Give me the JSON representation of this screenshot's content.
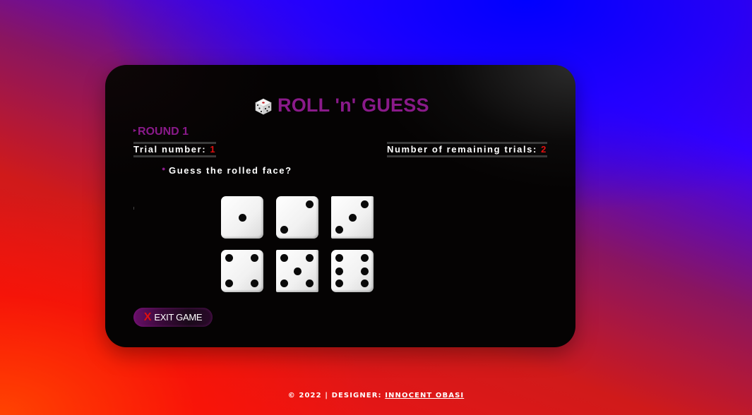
{
  "app": {
    "title": "ROLL 'n' GUESS",
    "title_icon": "dice-icon",
    "accent_color": "#8a1a8a",
    "highlight_color": "#e01010"
  },
  "round": {
    "label": "ROUND 1"
  },
  "trial": {
    "label": "Trial number: ",
    "value": "1"
  },
  "remaining": {
    "label": "Number of remaining trials: ",
    "value": "2"
  },
  "question": {
    "text": "Guess the rolled face?"
  },
  "dice": [
    {
      "face": 1,
      "name": "die-face-1"
    },
    {
      "face": 2,
      "name": "die-face-2"
    },
    {
      "face": 3,
      "name": "die-face-3"
    },
    {
      "face": 4,
      "name": "die-face-4"
    },
    {
      "face": 5,
      "name": "die-face-5"
    },
    {
      "face": 6,
      "name": "die-face-6"
    }
  ],
  "exit_button": {
    "icon": "X",
    "label": "EXIT GAME"
  },
  "footer": {
    "prefix": "© 2022 | DESIGNER: ",
    "designer": "INNOCENT OBASI"
  }
}
